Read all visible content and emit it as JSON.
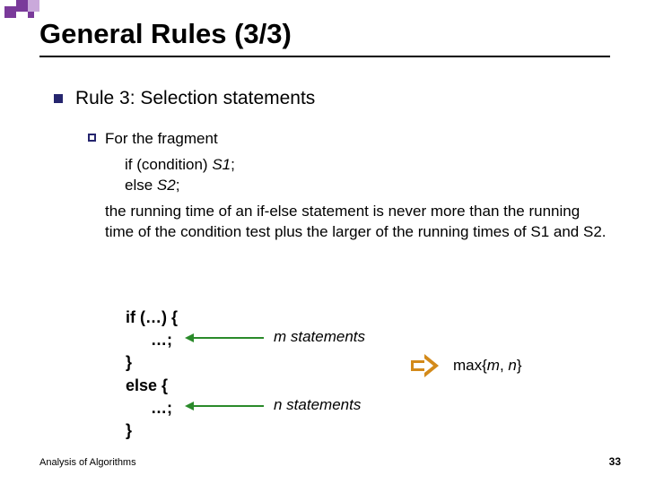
{
  "title": "General Rules (3/3)",
  "rule_heading": "Rule 3: Selection statements",
  "sub": {
    "lead": "For the fragment",
    "code_line1_pre": "if (condition) ",
    "code_line1_s": "S1",
    "code_line1_post": ";",
    "code_line2_pre": "else ",
    "code_line2_s": "S2",
    "code_line2_post": ";",
    "para": "the running time of an if-else statement is never more than the running time of the condition test plus the larger of the running times of S1 and S2."
  },
  "example": {
    "l1": "if (…) {",
    "l2": "…;",
    "l3": "}",
    "l4": "else {",
    "l5": "…;",
    "l6": "}",
    "m_label": "m statements",
    "n_label": "n statements",
    "max_label": "max{m, n}"
  },
  "footer": {
    "left": "Analysis of Algorithms",
    "page": "33"
  }
}
